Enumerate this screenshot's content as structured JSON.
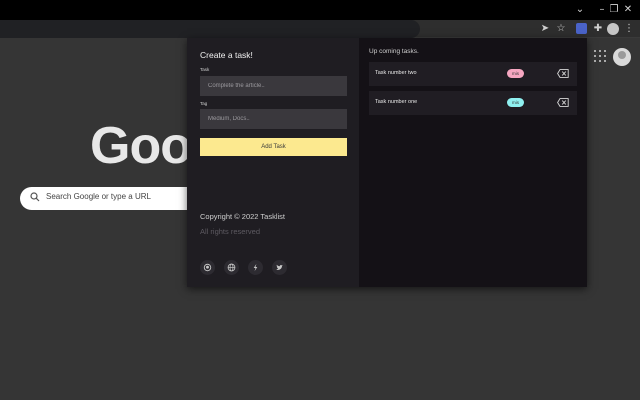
{
  "browser": {
    "omnibox_text": "",
    "colors": {
      "frame": "#000000",
      "toolbar": "#2e2e2e",
      "page_bg": "#353535"
    }
  },
  "google": {
    "logo_text": "Goog",
    "search_placeholder": "Search Google or type a URL"
  },
  "popup": {
    "form": {
      "title": "Create a task!",
      "task_label": "Task",
      "task_placeholder": "Complete the article..",
      "tag_label": "Tag",
      "tag_placeholder": "Medium, Docs..",
      "add_button": "Add Task"
    },
    "footer": {
      "copyright": "Copyright © 2022 Tasklist",
      "rights": "All rights reserved",
      "social_icons": [
        "github-icon",
        "globe-icon",
        "dev-icon",
        "twitter-icon"
      ]
    },
    "tasks_panel": {
      "title": "Up coming tasks.",
      "tasks": [
        {
          "name": "Task number two",
          "tag": "mis",
          "tag_color": "#f6a7c1"
        },
        {
          "name": "Task number one",
          "tag": "mis",
          "tag_color": "#8ff0f0"
        }
      ]
    },
    "colors": {
      "accent": "#fce98f",
      "left_bg": "#1f1d22",
      "right_bg": "#141116"
    }
  }
}
